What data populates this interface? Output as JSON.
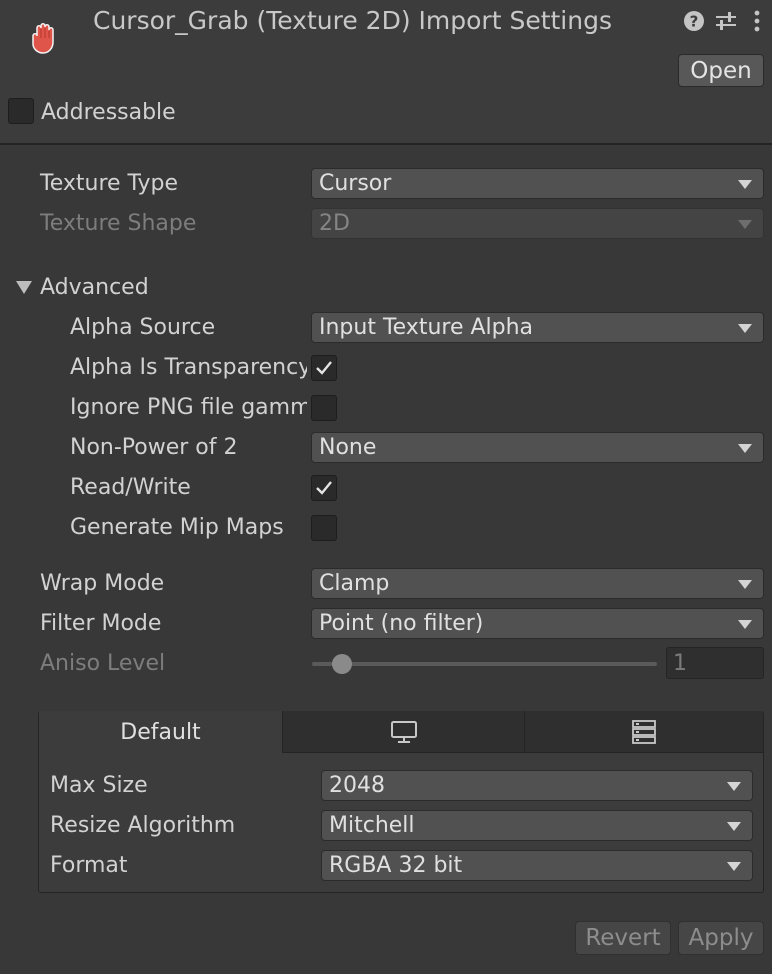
{
  "header": {
    "title": "Cursor_Grab (Texture 2D) Import Settings",
    "open_label": "Open",
    "addressable_label": "Addressable",
    "addressable_checked": false
  },
  "icons": {
    "asset": "hand-icon",
    "help": "help-icon",
    "presets": "sliders-icon",
    "menu": "kebab-menu-icon"
  },
  "settings": {
    "texture_type": {
      "label": "Texture Type",
      "value": "Cursor"
    },
    "texture_shape": {
      "label": "Texture Shape",
      "value": "2D"
    }
  },
  "advanced": {
    "label": "Advanced",
    "expanded": true,
    "alpha_source": {
      "label": "Alpha Source",
      "value": "Input Texture Alpha"
    },
    "alpha_is_transparency": {
      "label": "Alpha Is Transparency",
      "checked": true
    },
    "ignore_png_gamma": {
      "label": "Ignore PNG file gamma",
      "checked": false
    },
    "non_power_of_2": {
      "label": "Non-Power of 2",
      "value": "None"
    },
    "read_write": {
      "label": "Read/Write",
      "checked": true
    },
    "generate_mip_maps": {
      "label": "Generate Mip Maps",
      "checked": false
    }
  },
  "sampling": {
    "wrap_mode": {
      "label": "Wrap Mode",
      "value": "Clamp"
    },
    "filter_mode": {
      "label": "Filter Mode",
      "value": "Point (no filter)"
    },
    "aniso_level": {
      "label": "Aniso Level",
      "value": "1",
      "fraction": 0.06
    }
  },
  "platform_tabs": {
    "default_label": "Default",
    "tab2_icon": "monitor-icon",
    "tab3_icon": "server-icon"
  },
  "platform": {
    "max_size": {
      "label": "Max Size",
      "value": "2048"
    },
    "resize_algorithm": {
      "label": "Resize Algorithm",
      "value": "Mitchell"
    },
    "format": {
      "label": "Format",
      "value": "RGBA 32 bit"
    }
  },
  "footer": {
    "revert_label": "Revert",
    "apply_label": "Apply"
  },
  "colors": {
    "background": "#383838",
    "header": "#3c3c3c",
    "hand_icon": "#e0554a"
  }
}
